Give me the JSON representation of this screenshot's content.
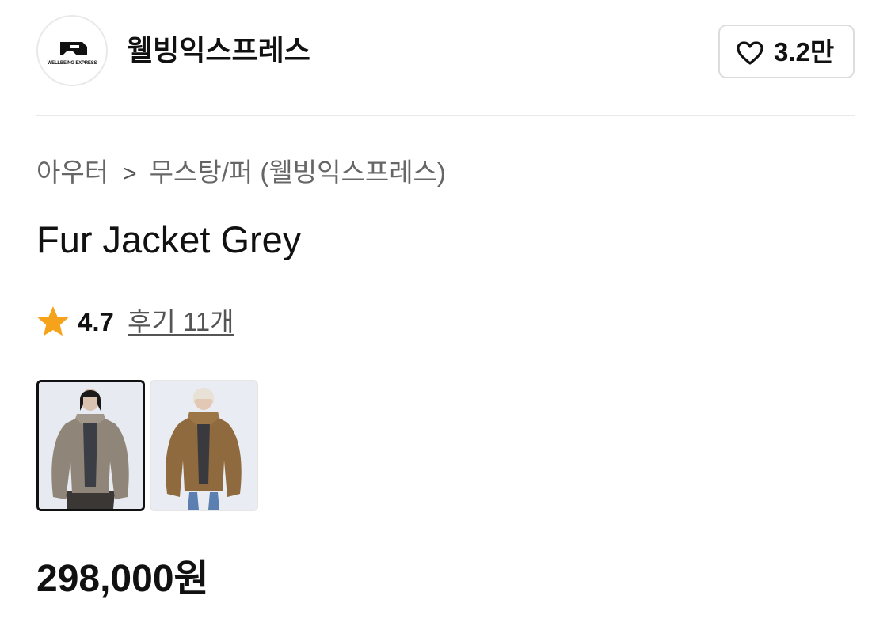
{
  "header": {
    "brand_name": "웰빙익스프레스",
    "logo_text": "WELLBEING EXPRESS",
    "like_count": "3.2만"
  },
  "breadcrumb": {
    "category": "아우터",
    "separator": ">",
    "subcategory": "무스탕/퍼 (웰빙익스프레스)"
  },
  "product": {
    "title": "Fur Jacket Grey",
    "rating": "4.7",
    "review_link": "후기 11개",
    "price": "298,000원",
    "thumbnails": [
      {
        "color_name": "grey",
        "selected": true
      },
      {
        "color_name": "brown",
        "selected": false
      }
    ]
  },
  "colors": {
    "star": "#F7A21B",
    "text_primary": "#111111",
    "text_secondary": "#666666",
    "border": "#dddddd"
  },
  "icons": {
    "like": "heart-icon",
    "rating": "star-icon",
    "breadcrumb": "chevron-right-icon"
  }
}
